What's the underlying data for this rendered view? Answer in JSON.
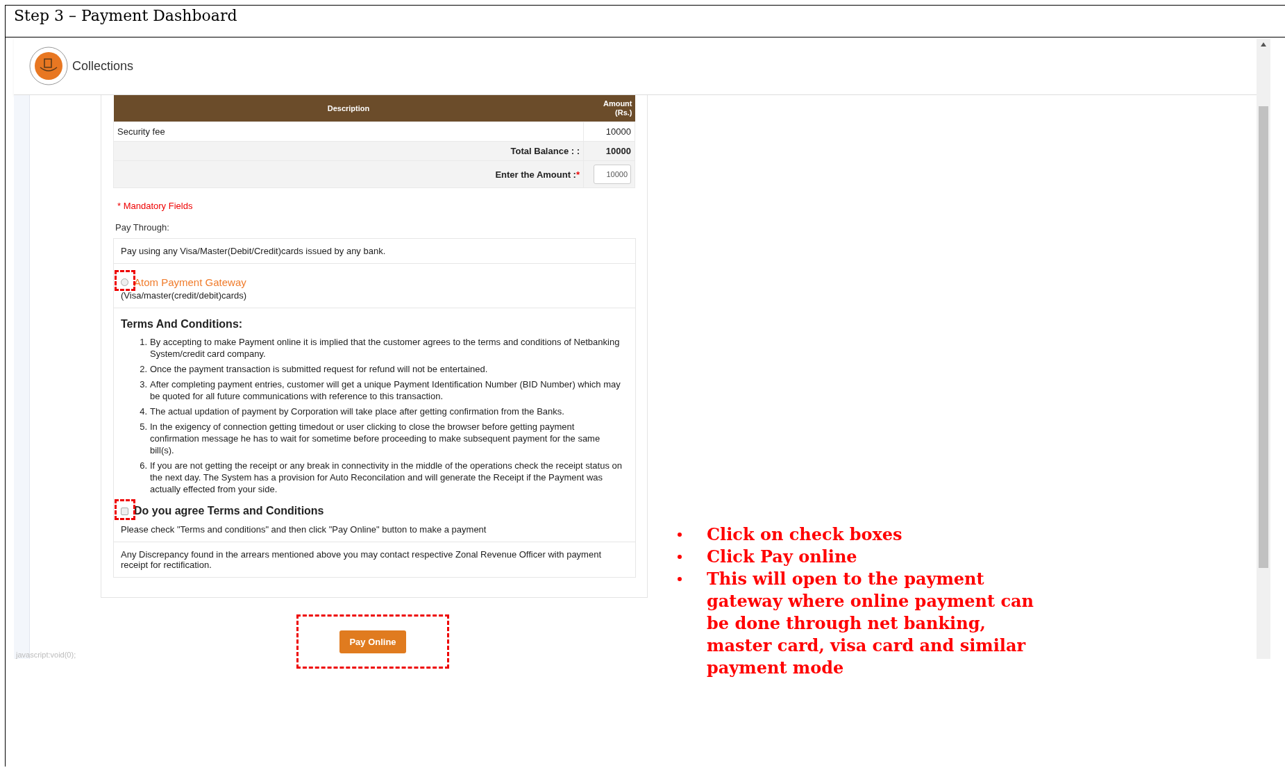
{
  "document": {
    "title": "Step 3 – Payment Dashboard"
  },
  "app": {
    "header": {
      "title": "Collections"
    },
    "table": {
      "columns": [
        "Description",
        "Amount (Rs.)"
      ],
      "rows": [
        {
          "description": "Security fee",
          "amount": "10000"
        }
      ],
      "total": {
        "label": "Total Balance : :",
        "value": "10000"
      },
      "amount_field": {
        "label": "Enter the Amount :",
        "required_mark": "*",
        "value": "10000"
      }
    },
    "mandatory_note": "* Mandatory Fields",
    "pay_through": {
      "label": "Pay Through:",
      "info": "Pay using any Visa/Master(Debit/Credit)cards issued by any bank.",
      "options": [
        {
          "label": "Atom Payment Gateway",
          "sublabel": "(Visa/master(credit/debit)cards)",
          "selected": false
        }
      ]
    },
    "terms": {
      "heading": "Terms And Conditions:",
      "items": [
        {
          "number": "1.",
          "text": "By accepting to make Payment online it is implied that the customer agrees to the terms and conditions of Netbanking System/credit card company."
        },
        {
          "number": "2.",
          "text": "Once the payment transaction is submitted request for refund will not be entertained."
        },
        {
          "number": "3.",
          "text": "After completing payment entries, customer will get a unique Payment Identification Number (BID Number) which may be quoted for all future communications with reference to this transaction."
        },
        {
          "number": "4.",
          "text": "The actual updation of payment by Corporation will take place after getting confirmation from the Banks."
        },
        {
          "number": "5.",
          "text": "In the exigency of connection getting timedout or user clicking to close the browser before getting payment confirmation message he has to wait for sometime before proceeding to make subsequent payment for the same bill(s)."
        },
        {
          "number": "6.",
          "text": "If you are not getting the receipt or any break in connectivity in the middle of the operations check the receipt status on the next day. The System has a provision for Auto Reconcilation and will generate the Receipt if the Payment was actually effected from your side."
        }
      ],
      "agree": {
        "label": "Do you agree Terms and Conditions",
        "checked": false
      },
      "hint": "Please check \"Terms and conditions\" and then click \"Pay Online\" button to make a payment"
    },
    "discrepancy_note": "Any Discrepancy found in the arrears mentioned above you may contact respective Zonal Revenue Officer with payment receipt for rectification.",
    "pay_button": "Pay Online",
    "status_text": "javascript:void(0);"
  },
  "instructions": [
    "Click on check boxes",
    "Click Pay online",
    "This will open to the payment gateway where online payment can be done through net banking, master card, visa card and similar payment mode"
  ]
}
